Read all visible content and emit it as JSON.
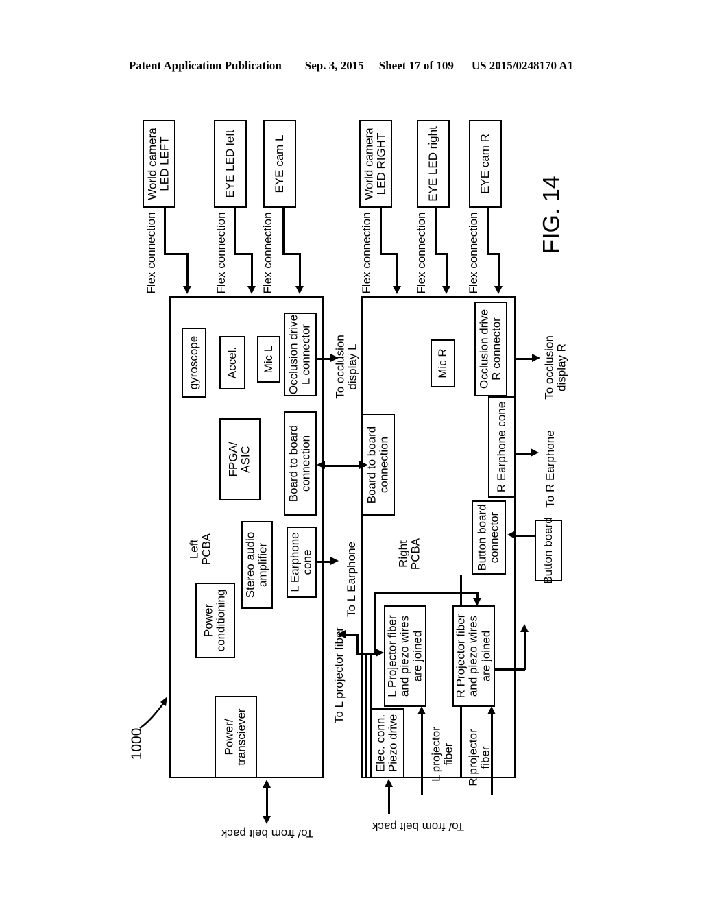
{
  "header": {
    "publication": "Patent Application Publication",
    "date": "Sep. 3, 2015",
    "sheet": "Sheet 17 of 109",
    "patent_number": "US 2015/0248170 A1"
  },
  "figure": {
    "number": "FIG. 14",
    "reference_numeral": "1000"
  },
  "top_components": {
    "left": [
      {
        "label": "World camera\nLED LEFT",
        "connection": "Flex connection"
      },
      {
        "label": "EYE LED left",
        "connection": "Flex connection"
      },
      {
        "label": "EYE cam L",
        "connection": "Flex connection"
      }
    ],
    "right": [
      {
        "label": "World camera\nLED RIGHT",
        "connection": "Flex connection"
      },
      {
        "label": "EYE LED right",
        "connection": "Flex connection"
      },
      {
        "label": "EYE cam R",
        "connection": "Flex connection"
      }
    ]
  },
  "left_board": {
    "title": "Left\nPCBA",
    "blocks": [
      {
        "name": "gyroscope",
        "label": "gyroscope"
      },
      {
        "name": "accelerometer",
        "label": "Accel."
      },
      {
        "name": "mic-l",
        "label": "Mic L"
      },
      {
        "name": "occlusion-drive-l-connector",
        "label": "Occlusion drive\nL connector"
      },
      {
        "name": "fpga-asic",
        "label": "FPGA/\nASIC"
      },
      {
        "name": "board-to-board-connection-left",
        "label": "Board to board\nconnection"
      },
      {
        "name": "power-conditioning",
        "label": "Power\nconditioning"
      },
      {
        "name": "stereo-audio-amplifier",
        "label": "Stereo audio\namplifier"
      },
      {
        "name": "l-earphone-cone",
        "label": "L Earphone\ncone"
      },
      {
        "name": "power-transciever",
        "label": "Power/\ntransciever"
      }
    ]
  },
  "right_board": {
    "title": "Right\nPCBA",
    "blocks": [
      {
        "name": "occlusion-drive-r-connector",
        "label": "Occlusion drive\nR connector"
      },
      {
        "name": "mic-r",
        "label": "Mic R"
      },
      {
        "name": "board-to-board-connection-right",
        "label": "Board to board\nconnection"
      },
      {
        "name": "r-earphone-cone",
        "label": "R Earphone cone"
      },
      {
        "name": "button-board-connector",
        "label": "Button board\nconnector"
      },
      {
        "name": "l-projector-fiber-joined",
        "label": "L Projector fiber\nand piezo wires\nare joined"
      },
      {
        "name": "r-projector-fiber-joined",
        "label": "R Projector fiber\nand piezo wires\nare joined"
      },
      {
        "name": "elec-conn-piezo-drive",
        "label": "Elec. conn.\nPiezo drive"
      }
    ]
  },
  "external": {
    "button_board": "Button board"
  },
  "annotations": {
    "to_occlusion_display_l": "To occlusion\ndisplay L",
    "to_occlusion_display_r": "To occlusion\ndisplay R",
    "to_l_earphone": "To L Earphone",
    "to_r_earphone": "To R Earphone",
    "to_l_projector_fiber": "To L projector fiber",
    "l_projector_fiber": "L projector\nfiber",
    "r_projector_fiber": "R projector\nfiber",
    "belt_pack_left": "To/ from belt pack",
    "belt_pack_right": "To/ from belt pack"
  }
}
